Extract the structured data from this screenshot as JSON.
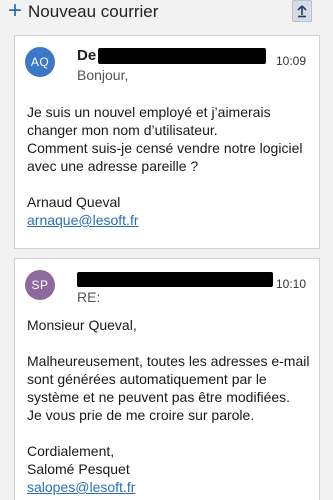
{
  "toolbar": {
    "new_mail_label": "Nouveau courrier",
    "new_mail_icon": "plus-icon",
    "upload_icon": "upload-icon"
  },
  "messages": [
    {
      "avatar_initials": "AQ",
      "avatar_color": "#3d78c7",
      "sender_prefix": "De",
      "preview": "Bonjour,",
      "time": "10:09",
      "body_lines": [
        "Je suis un nouvel employé et j’aimerais",
        "changer mon nom d’utilisateur.",
        "Comment suis-je censé vendre notre logiciel",
        "avec une adresse pareille ?"
      ],
      "signature_name": "Arnaud Queval",
      "signature_email": "arnaque@lesoft.fr"
    },
    {
      "avatar_initials": "SP",
      "avatar_color": "#8e6a9e",
      "preview": "RE:",
      "time": "10:10",
      "greeting": "Monsieur Queval,",
      "body_lines": [
        "Malheureusement, toutes les adresses e-mail",
        "sont générées automatiquement par le",
        "système et ne peuvent pas être modifiées.",
        "Je vous prie de me croire sur parole."
      ],
      "closing": "Cordialement,",
      "signature_name": "Salomé Pesquet",
      "signature_email": "salopes@lesoft.fr"
    }
  ],
  "colors": {
    "accent": "#2b6cb0",
    "link": "#2a6fb8"
  }
}
